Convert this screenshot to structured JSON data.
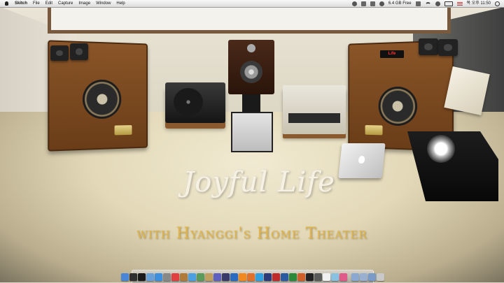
{
  "menubar": {
    "app_name": "Skitch",
    "items": [
      "File",
      "Edit",
      "Capture",
      "Image",
      "Window",
      "Help"
    ],
    "status": {
      "disk_free": "6.4 GB Free",
      "clock": "목 오후 11:50"
    }
  },
  "wallpaper": {
    "title": "Joyful Life",
    "subtitle": "with Hyanggi's Home Theater",
    "clock_display": "Life"
  },
  "dock": {
    "icons": [
      {
        "name": "finder-icon",
        "color": "#4a86d8"
      },
      {
        "name": "dashboard-icon",
        "color": "#2f2f2f"
      },
      {
        "name": "expose-icon",
        "color": "#1a1a1a"
      },
      {
        "name": "mail-icon",
        "color": "#6aa0d8"
      },
      {
        "name": "safari-icon",
        "color": "#3d8fe0"
      },
      {
        "name": "system-preferences-icon",
        "color": "#888888"
      },
      {
        "name": "ical-icon",
        "color": "#e04040"
      },
      {
        "name": "address-book-icon",
        "color": "#b07a3a"
      },
      {
        "name": "itunes-icon",
        "color": "#4aa0e0"
      },
      {
        "name": "iphoto-icon",
        "color": "#5a9a5a"
      },
      {
        "name": "garageband-icon",
        "color": "#c0a060"
      },
      {
        "name": "imovie-icon",
        "color": "#6060c0"
      },
      {
        "name": "idvd-icon",
        "color": "#3a3a6a"
      },
      {
        "name": "quicktime-icon",
        "color": "#2a6ac0"
      },
      {
        "name": "vlc-icon",
        "color": "#f08a20"
      },
      {
        "name": "firefox-icon",
        "color": "#e0702a"
      },
      {
        "name": "skype-icon",
        "color": "#30a0e0"
      },
      {
        "name": "photoshop-icon",
        "color": "#2a3a7a"
      },
      {
        "name": "pdf-reader-icon",
        "color": "#c02a2a"
      },
      {
        "name": "word-icon",
        "color": "#2a5aa0"
      },
      {
        "name": "excel-icon",
        "color": "#2a8a3a"
      },
      {
        "name": "powerpoint-icon",
        "color": "#d0602a"
      },
      {
        "name": "terminal-icon",
        "color": "#222222"
      },
      {
        "name": "activity-monitor-icon",
        "color": "#5a5a5a"
      },
      {
        "name": "text-edit-icon",
        "color": "#f0f0f0"
      },
      {
        "name": "preview-icon",
        "color": "#8ac0e0"
      },
      {
        "name": "skitch-icon",
        "color": "#e05a8a"
      },
      {
        "name": "applications-folder-icon",
        "color": "#8aa8d0"
      },
      {
        "name": "documents-folder-icon",
        "color": "#9ab0d0"
      },
      {
        "name": "downloads-folder-icon",
        "color": "#7a9ac8"
      },
      {
        "name": "trash-icon",
        "color": "#c8c8c8"
      }
    ]
  }
}
